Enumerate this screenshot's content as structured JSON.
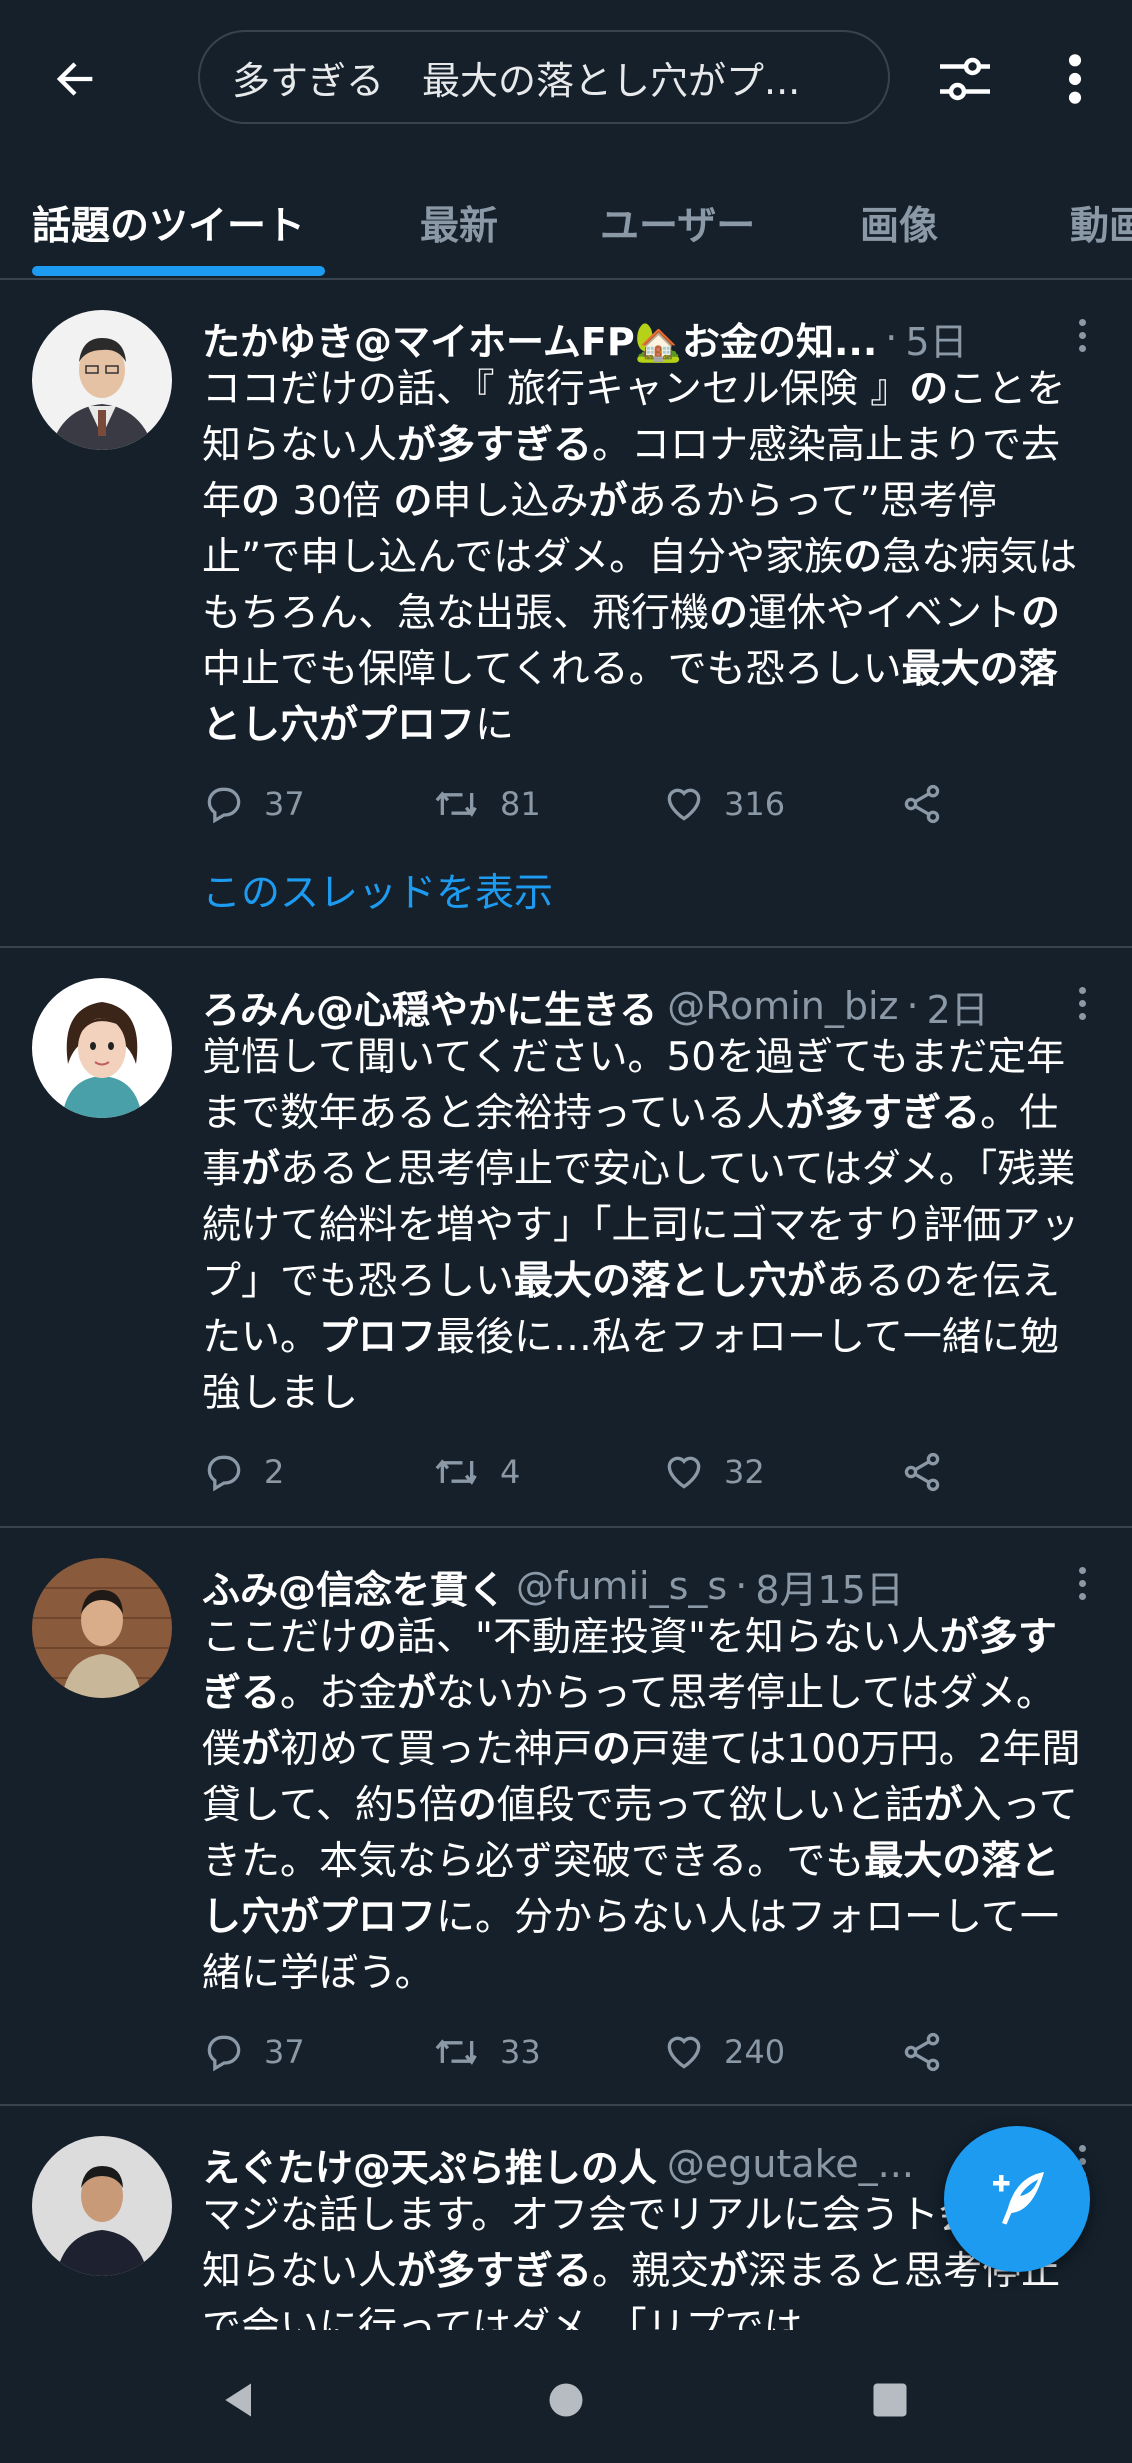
{
  "search": {
    "query": "多すぎる　最大の落とし穴がプ..."
  },
  "tabs": [
    {
      "label": "話題のツイート"
    },
    {
      "label": "最新"
    },
    {
      "label": "ユーザー"
    },
    {
      "label": "画像"
    },
    {
      "label": "動画"
    }
  ],
  "tweets": [
    {
      "name": "たかゆき@マイホームFP🏡お金の知...",
      "handle": "",
      "time": "5日",
      "text_html": "ココだけの話、『 旅行キャンセル保険 』<b>の</b>ことを知らない人<b>が多すぎる</b>。コロナ感染高止まりで去年<b>の</b> 30倍 <b>の</b>申し込み<b>が</b>あるからって”思考停止”で申し込んではダメ。自分や家族<b>の</b>急な病気はもちろん、急な出張、飛行機<b>の</b>運休やイベント<b>の</b>中止でも保障してくれる。でも恐ろしい<b>最大の落とし穴がプロフ</b>に",
      "replies": "37",
      "retweets": "81",
      "likes": "316",
      "thread_link": "このスレッドを表示"
    },
    {
      "name": "ろみん@心穏やかに生きる",
      "handle": "@Romin_biz",
      "time": "2日",
      "text_html": "覚悟して聞いてください。50を過ぎてもまだ定年まで数年あると余裕持っている人<b>が多すぎる</b>。仕事<b>が</b>あると思考停止で安心していてはダメ。「残業続けて給料を増やす」「上司にゴマをすり評価アップ」でも恐ろしい<b>最大の落とし穴が</b>あるのを伝えたい。<b>プロフ</b>最後に…私をフォローして一緒に勉強しまし",
      "replies": "2",
      "retweets": "4",
      "likes": "32"
    },
    {
      "name": "ふみ@信念を貫く",
      "handle": "@fumii_s_s",
      "time": "8月15日",
      "text_html": "ここだけ<b>の</b>話、\"不動産投資\"を知らない人<b>が多すぎる</b>。お金<b>が</b>ないからって思考停止してはダメ。僕<b>が</b>初めて買った神戸<b>の</b>戸建ては100万円。2年間貸して、約5倍<b>の</b>値段で売って欲しいと話<b>が</b>入ってきた。本気なら必ず突破できる。でも<b>最大の落とし穴がプロフ</b>に。分からない人はフォローして一緒に学ぼう。",
      "replies": "37",
      "retweets": "33",
      "likes": "240"
    },
    {
      "name": "えぐたけ@天ぷら推しの人",
      "handle": "@egutake_...",
      "time": "",
      "text_html": "マジな話します。オフ会でリアルに会うト会トを知らない人<b>が多すぎる</b>。親交<b>が</b>深まると思考停止で会いに行ってはダメ。「リプでは"
    }
  ],
  "colors": {
    "background": "#15202b",
    "accent": "#1d9bf0",
    "muted": "#8b98a5",
    "divider": "#38444d"
  }
}
